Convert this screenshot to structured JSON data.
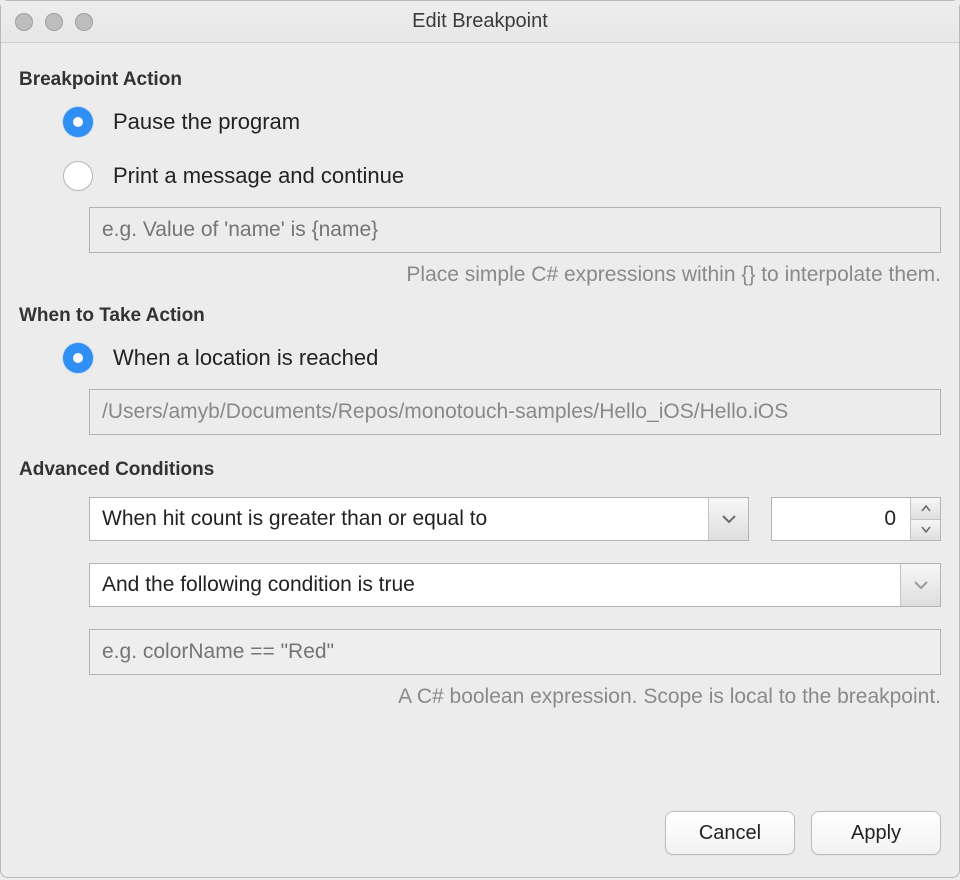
{
  "window": {
    "title": "Edit Breakpoint"
  },
  "breakpoint_action": {
    "heading": "Breakpoint Action",
    "pause_label": "Pause the program",
    "print_label": "Print a message and continue",
    "message_placeholder": "e.g. Value of 'name' is {name}",
    "message_value": "",
    "hint": "Place simple C# expressions within {} to interpolate them.",
    "selected": "pause"
  },
  "when": {
    "heading": "When to Take Action",
    "location_label": "When a location is reached",
    "path_value": "/Users/amyb/Documents/Repos/monotouch-samples/Hello_iOS/Hello.iOS",
    "selected": "location"
  },
  "advanced": {
    "heading": "Advanced Conditions",
    "hitcount_combo": "When hit count is greater than or equal to",
    "hitcount_value": "0",
    "condition_combo": "And the following condition is true",
    "condition_placeholder": "e.g. colorName == \"Red\"",
    "condition_value": "",
    "hint": "A C# boolean expression. Scope is local to the breakpoint."
  },
  "buttons": {
    "cancel": "Cancel",
    "apply": "Apply"
  }
}
